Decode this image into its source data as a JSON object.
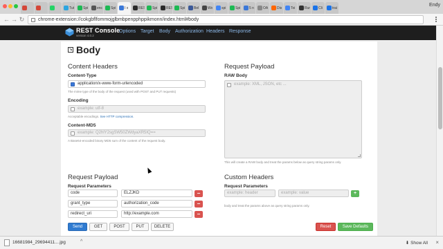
{
  "browser": {
    "user_name": "Endy",
    "url": "chrome-extension://cokgbflfommojglbmbpenpphppikmonn/index.html#body",
    "tabs": [
      {
        "title": "",
        "color": "#d44638"
      },
      {
        "title": "",
        "color": "#d44638"
      },
      {
        "title": "",
        "color": "#25d366"
      },
      {
        "title": "Tut",
        "color": "#2ca5e0"
      },
      {
        "title": "Spi",
        "color": "#1db954"
      },
      {
        "title": "enc",
        "color": "#555555"
      },
      {
        "title": "Spi",
        "color": "#1db954"
      },
      {
        "title": "I x",
        "color": "#3b78d8",
        "active": true
      },
      {
        "title": "RES",
        "color": "#2a2a2a"
      },
      {
        "title": "Spi",
        "color": "#1db954"
      },
      {
        "title": "RES",
        "color": "#2a2a2a"
      },
      {
        "title": "Spi",
        "color": "#1db954"
      },
      {
        "title": "Bel",
        "color": "#3b5998"
      },
      {
        "title": "Wo",
        "color": "#444444"
      },
      {
        "title": "spi",
        "color": "#4285f4"
      },
      {
        "title": "Spi",
        "color": "#1db954"
      },
      {
        "title": "5 n",
        "color": "#3b78d8"
      },
      {
        "title": "OA",
        "color": "#888888"
      },
      {
        "title": "Dis",
        "color": "#ff6600"
      },
      {
        "title": "Toi",
        "color": "#4285f4"
      },
      {
        "title": "Rur",
        "color": "#333333"
      },
      {
        "title": "Cli",
        "color": "#1a73e8"
      },
      {
        "title": "trai",
        "color": "#1a73e8"
      }
    ]
  },
  "app": {
    "brand": "REST Console",
    "version": "version 4.0.2",
    "nav": [
      "Options",
      "Target",
      "Body",
      "Authorization",
      "Headers",
      "Response"
    ]
  },
  "body": {
    "title": "Body",
    "content_headers": {
      "heading": "Content Headers",
      "content_type": {
        "label": "Content-Type",
        "value": "application/x-www-form-urlencoded",
        "help": "The mime type of the body of the request (used with POST and PUT requests)"
      },
      "encoding": {
        "label": "Encoding",
        "placeholder": "example: utf-8",
        "help": "Acceptable encodings.",
        "help_link": "See HTTP compression."
      },
      "content_md5": {
        "label": "Content-MD5",
        "placeholder": "example: Q2hlY2sgSW50ZWdyaXR5IQ==",
        "help": "A Base64-encoded binary MD5 sum of the content of the request body."
      }
    },
    "request_payload_right": {
      "heading": "Request Payload",
      "raw_label": "RAW Body",
      "raw_placeholder": "example: XML, JSON, etc ...",
      "help": "This will create a RAW body and treat the params below as query string params only."
    },
    "request_payload_left": {
      "heading": "Request Payload",
      "params_label": "Request Parameters",
      "params": [
        {
          "key": "code",
          "value": "ELZJKD"
        },
        {
          "key": "grant_type",
          "value": "authorization_code"
        },
        {
          "key": "redirect_uri",
          "value": "http://example.com"
        }
      ],
      "remove_symbol": "−"
    },
    "custom_headers": {
      "heading": "Custom Headers",
      "params_label": "Request Parameters",
      "header_placeholder": "example: header",
      "value_placeholder": "example: value",
      "add_symbol": "+",
      "help": "body and treat the params above as query string params only."
    }
  },
  "actions": {
    "send": "Send",
    "get": "GET",
    "post": "POST",
    "put": "PUT",
    "delete": "DELETE",
    "reset": "Reset",
    "save_defaults": "Save Defaults"
  },
  "downloads": {
    "filename": "16681984_29694411....jpg",
    "chevron": "^",
    "show_all": "Show All",
    "close": "×"
  }
}
